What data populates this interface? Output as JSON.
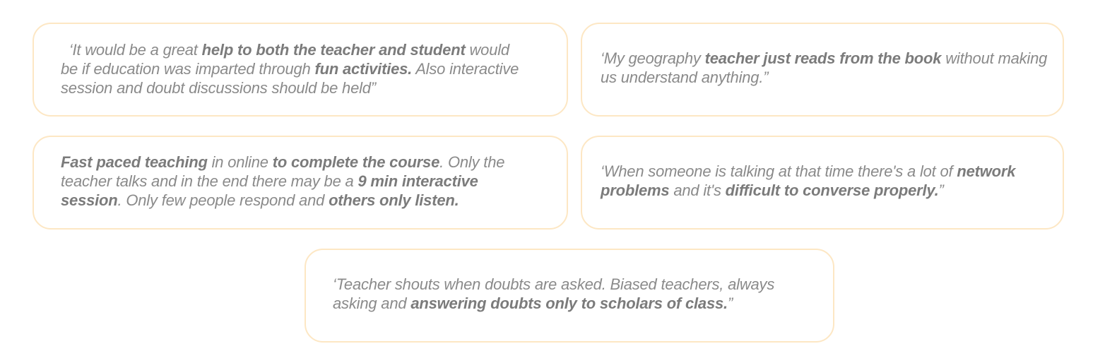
{
  "quotes": [
    {
      "lines": [
        [
          {
            "t": "  ‘It would be a great ",
            "b": false
          },
          {
            "t": "help to both the teacher and student",
            "b": true
          },
          {
            "t": " would",
            "b": false
          }
        ],
        [
          {
            "t": "be if education was imparted through ",
            "b": false
          },
          {
            "t": "fun activities.",
            "b": true
          },
          {
            "t": " Also interactive",
            "b": false
          }
        ],
        [
          {
            "t": "session and doubt discussions should be held”",
            "b": false
          }
        ]
      ]
    },
    {
      "lines": [
        [
          {
            "t": "‘My geography ",
            "b": false
          },
          {
            "t": "teacher just reads from the book",
            "b": true
          },
          {
            "t": " without making",
            "b": false
          }
        ],
        [
          {
            "t": "us understand anything.”",
            "b": false
          }
        ]
      ]
    },
    {
      "lines": [
        [
          {
            "t": "Fast paced teaching",
            "b": true
          },
          {
            "t": " in online ",
            "b": false
          },
          {
            "t": "to complete the course",
            "b": true
          },
          {
            "t": ". Only the",
            "b": false
          }
        ],
        [
          {
            "t": "teacher talks and in the end there may be a ",
            "b": false
          },
          {
            "t": "9 min interactive",
            "b": true
          }
        ],
        [
          {
            "t": "session",
            "b": true
          },
          {
            "t": ". Only few people respond and ",
            "b": false
          },
          {
            "t": "others only listen.",
            "b": true
          }
        ]
      ]
    },
    {
      "lines": [
        [
          {
            "t": "‘When someone is talking at that time there's a lot of ",
            "b": false
          },
          {
            "t": "network",
            "b": true
          }
        ],
        [
          {
            "t": "problems",
            "b": true
          },
          {
            "t": " and it's ",
            "b": false
          },
          {
            "t": "difficult to converse properly.",
            "b": true
          },
          {
            "t": "”",
            "b": false
          }
        ]
      ]
    },
    {
      "lines": [
        [
          {
            "t": "‘Teacher shouts when doubts are asked. Biased teachers, always",
            "b": false
          }
        ],
        [
          {
            "t": "asking and ",
            "b": false
          },
          {
            "t": "answering doubts only to scholars of class.",
            "b": true
          },
          {
            "t": "”",
            "b": false
          }
        ]
      ]
    }
  ],
  "colors": {
    "card_border": "#fde7c4",
    "text": "#8a8a8a",
    "text_bold": "#7b7b7b"
  }
}
